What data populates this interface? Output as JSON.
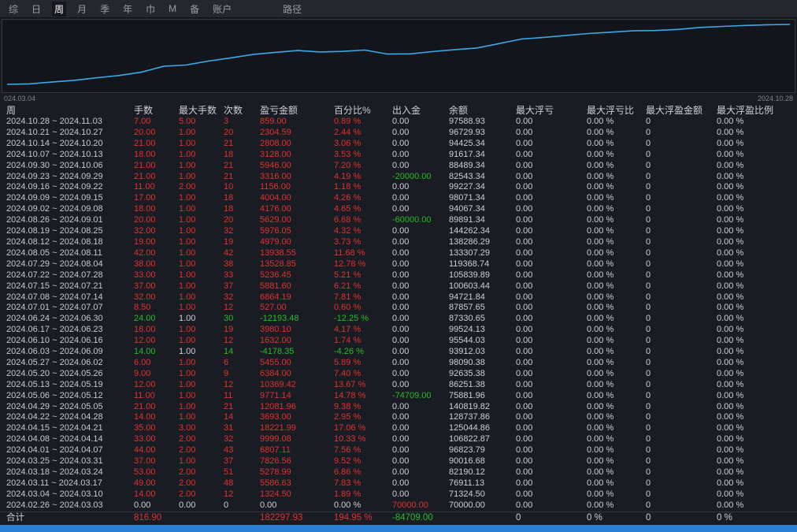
{
  "menu": {
    "items": [
      {
        "label": "综",
        "selected": false
      },
      {
        "label": "日",
        "selected": false
      },
      {
        "label": "周",
        "selected": true
      },
      {
        "label": "月",
        "selected": false
      },
      {
        "label": "季",
        "selected": false
      },
      {
        "label": "年",
        "selected": false
      },
      {
        "label": "巾",
        "selected": false
      },
      {
        "label": "M",
        "selected": false
      },
      {
        "label": "备",
        "selected": false
      },
      {
        "label": "账户",
        "selected": false
      },
      {
        "label": "路径",
        "selected": false,
        "far": true
      }
    ]
  },
  "chart": {
    "start_label": "024.03.04",
    "end_label": "2024.10.28",
    "line_color": "#3da8e8"
  },
  "chart_data": {
    "type": "line",
    "title": "",
    "x_axis": {
      "start": "024.03.04",
      "end": "2024.10.28"
    },
    "ylim": [
      0,
      182297.93
    ],
    "grid": false,
    "legend": "none",
    "series": [
      {
        "name": "cumulative-pnl",
        "values": [
          0,
          1324.5,
          6911.13,
          12190.12,
          20016.68,
          26823.79,
          36822.87,
          55044.86,
          58737.86,
          70819.82,
          80590.96,
          90960.38,
          97344.38,
          102799.38,
          98621.03,
          100253.03,
          104233.13,
          92039.65,
          92566.65,
          99430.84,
          105312.44,
          110548.89,
          124077.74,
          138016.29,
          142995.29,
          148971.34,
          154600.34,
          158776.34,
          162780.34,
          163936.34,
          167252.34,
          173198.34,
          176326.34,
          179134.34,
          181438.93,
          182297.93
        ]
      }
    ]
  },
  "colors": {
    "gain_red": "#e03232",
    "loss_green": "#28bc28",
    "text": "#ccd0d6",
    "chart_line": "#3da8e8",
    "bottom_bar": "#2b7fd4"
  },
  "table": {
    "headers": [
      "周",
      "手数",
      "最大手数",
      "次数",
      "盈亏金额",
      "百分比%",
      "出入金",
      "余额",
      "最大浮亏",
      "最大浮亏比",
      "最大浮盈金额",
      "最大浮盈比例"
    ],
    "float_cols": {
      "max_float_loss": "0.00",
      "max_float_loss_pct": "0.00 %",
      "max_float_profit": "0",
      "max_float_profit_pct": "0.00 %"
    },
    "rows": [
      {
        "p": "2024.10.28 ~ 2024.11.03",
        "l": "7.00",
        "ml": "5.00",
        "n": "3",
        "pnl": "859.00",
        "pct": "0.89 %",
        "cash": "0.00",
        "bal": "97588.93",
        "tone": "pos",
        "ct": "neutral"
      },
      {
        "p": "2024.10.21 ~ 2024.10.27",
        "l": "20.00",
        "ml": "1.00",
        "n": "20",
        "pnl": "2304.59",
        "pct": "2.44 %",
        "cash": "0.00",
        "bal": "96729.93",
        "tone": "pos",
        "ct": "neutral"
      },
      {
        "p": "2024.10.14 ~ 2024.10.20",
        "l": "21.00",
        "ml": "1.00",
        "n": "21",
        "pnl": "2808.00",
        "pct": "3.06 %",
        "cash": "0.00",
        "bal": "94425.34",
        "tone": "pos",
        "ct": "neutral"
      },
      {
        "p": "2024.10.07 ~ 2024.10.13",
        "l": "18.00",
        "ml": "1.00",
        "n": "18",
        "pnl": "3128.00",
        "pct": "3.53 %",
        "cash": "0.00",
        "bal": "91617.34",
        "tone": "pos",
        "ct": "neutral"
      },
      {
        "p": "2024.09.30 ~ 2024.10.06",
        "l": "21.00",
        "ml": "1.00",
        "n": "21",
        "pnl": "5946.00",
        "pct": "7.20 %",
        "cash": "0.00",
        "bal": "88489.34",
        "tone": "pos",
        "ct": "neutral"
      },
      {
        "p": "2024.09.23 ~ 2024.09.29",
        "l": "21.00",
        "ml": "1.00",
        "n": "21",
        "pnl": "3316.00",
        "pct": "4.19 %",
        "cash": "-20000.00",
        "bal": "82543.34",
        "tone": "pos",
        "ct": "neg"
      },
      {
        "p": "2024.09.16 ~ 2024.09.22",
        "l": "11.00",
        "ml": "2.00",
        "n": "10",
        "pnl": "1156.00",
        "pct": "1.18 %",
        "cash": "0.00",
        "bal": "99227.34",
        "tone": "pos",
        "ct": "neutral"
      },
      {
        "p": "2024.09.09 ~ 2024.09.15",
        "l": "17.00",
        "ml": "1.00",
        "n": "18",
        "pnl": "4004.00",
        "pct": "4.26 %",
        "cash": "0.00",
        "bal": "98071.34",
        "tone": "pos",
        "ct": "neutral"
      },
      {
        "p": "2024.09.02 ~ 2024.09.08",
        "l": "18.00",
        "ml": "1.00",
        "n": "18",
        "pnl": "4176.00",
        "pct": "4.65 %",
        "cash": "0.00",
        "bal": "94067.34",
        "tone": "pos",
        "ct": "neutral"
      },
      {
        "p": "2024.08.26 ~ 2024.09.01",
        "l": "20.00",
        "ml": "1.00",
        "n": "20",
        "pnl": "5629.00",
        "pct": "6.68 %",
        "cash": "-60000.00",
        "bal": "89891.34",
        "tone": "pos",
        "ct": "neg"
      },
      {
        "p": "2024.08.19 ~ 2024.08.25",
        "l": "32.00",
        "ml": "1.00",
        "n": "32",
        "pnl": "5976.05",
        "pct": "4.32 %",
        "cash": "0.00",
        "bal": "144262.34",
        "tone": "pos",
        "ct": "neutral"
      },
      {
        "p": "2024.08.12 ~ 2024.08.18",
        "l": "19.00",
        "ml": "1.00",
        "n": "19",
        "pnl": "4979.00",
        "pct": "3.73 %",
        "cash": "0.00",
        "bal": "138286.29",
        "tone": "pos",
        "ct": "neutral"
      },
      {
        "p": "2024.08.05 ~ 2024.08.11",
        "l": "42.00",
        "ml": "1.00",
        "n": "42",
        "pnl": "13938.55",
        "pct": "11.68 %",
        "cash": "0.00",
        "bal": "133307.29",
        "tone": "pos",
        "ct": "neutral"
      },
      {
        "p": "2024.07.29 ~ 2024.08.04",
        "l": "38.00",
        "ml": "1.00",
        "n": "38",
        "pnl": "13528.85",
        "pct": "12.78 %",
        "cash": "0.00",
        "bal": "119368.74",
        "tone": "pos",
        "ct": "neutral"
      },
      {
        "p": "2024.07.22 ~ 2024.07.28",
        "l": "33.00",
        "ml": "1.00",
        "n": "33",
        "pnl": "5236.45",
        "pct": "5.21 %",
        "cash": "0.00",
        "bal": "105839.89",
        "tone": "pos",
        "ct": "neutral"
      },
      {
        "p": "2024.07.15 ~ 2024.07.21",
        "l": "37.00",
        "ml": "1.00",
        "n": "37",
        "pnl": "5881.60",
        "pct": "6.21 %",
        "cash": "0.00",
        "bal": "100603.44",
        "tone": "pos",
        "ct": "neutral"
      },
      {
        "p": "2024.07.08 ~ 2024.07.14",
        "l": "32.00",
        "ml": "1.00",
        "n": "32",
        "pnl": "6864.19",
        "pct": "7.81 %",
        "cash": "0.00",
        "bal": "94721.84",
        "tone": "pos",
        "ct": "neutral"
      },
      {
        "p": "2024.07.01 ~ 2024.07.07",
        "l": "8.50",
        "ml": "1.00",
        "n": "12",
        "pnl": "527.00",
        "pct": "0.60 %",
        "cash": "0.00",
        "bal": "87857.65",
        "tone": "pos",
        "ct": "neutral"
      },
      {
        "p": "2024.06.24 ~ 2024.06.30",
        "l": "24.00",
        "ml": "1.00",
        "n": "30",
        "pnl": "-12193.48",
        "pct": "-12.25 %",
        "cash": "0.00",
        "bal": "87330.65",
        "tone": "neg",
        "ct": "neutral"
      },
      {
        "p": "2024.06.17 ~ 2024.06.23",
        "l": "18.00",
        "ml": "1.00",
        "n": "19",
        "pnl": "3980.10",
        "pct": "4.17 %",
        "cash": "0.00",
        "bal": "99524.13",
        "tone": "pos",
        "ct": "neutral"
      },
      {
        "p": "2024.06.10 ~ 2024.06.16",
        "l": "12.00",
        "ml": "1.00",
        "n": "12",
        "pnl": "1632.00",
        "pct": "1.74 %",
        "cash": "0.00",
        "bal": "95544.03",
        "tone": "pos",
        "ct": "neutral"
      },
      {
        "p": "2024.06.03 ~ 2024.06.09",
        "l": "14.00",
        "ml": "1.00",
        "n": "14",
        "pnl": "-4178.35",
        "pct": "-4.26 %",
        "cash": "0.00",
        "bal": "93912.03",
        "tone": "neg",
        "ct": "neutral"
      },
      {
        "p": "2024.05.27 ~ 2024.06.02",
        "l": "6.00",
        "ml": "1.00",
        "n": "6",
        "pnl": "5455.00",
        "pct": "5.89 %",
        "cash": "0.00",
        "bal": "98090.38",
        "tone": "pos",
        "ct": "neutral"
      },
      {
        "p": "2024.05.20 ~ 2024.05.26",
        "l": "9.00",
        "ml": "1.00",
        "n": "9",
        "pnl": "6384.00",
        "pct": "7.40 %",
        "cash": "0.00",
        "bal": "92635.38",
        "tone": "pos",
        "ct": "neutral"
      },
      {
        "p": "2024.05.13 ~ 2024.05.19",
        "l": "12.00",
        "ml": "1.00",
        "n": "12",
        "pnl": "10369.42",
        "pct": "13.67 %",
        "cash": "0.00",
        "bal": "86251.38",
        "tone": "pos",
        "ct": "neutral"
      },
      {
        "p": "2024.05.06 ~ 2024.05.12",
        "l": "11.00",
        "ml": "1.00",
        "n": "11",
        "pnl": "9771.14",
        "pct": "14.78 %",
        "cash": "-74709.00",
        "bal": "75881.96",
        "tone": "pos",
        "ct": "neg"
      },
      {
        "p": "2024.04.29 ~ 2024.05.05",
        "l": "21.00",
        "ml": "1.00",
        "n": "21",
        "pnl": "12081.96",
        "pct": "9.38 %",
        "cash": "0.00",
        "bal": "140819.82",
        "tone": "pos",
        "ct": "neutral"
      },
      {
        "p": "2024.04.22 ~ 2024.04.28",
        "l": "14.00",
        "ml": "1.00",
        "n": "14",
        "pnl": "3693.00",
        "pct": "2.95 %",
        "cash": "0.00",
        "bal": "128737.86",
        "tone": "pos",
        "ct": "neutral"
      },
      {
        "p": "2024.04.15 ~ 2024.04.21",
        "l": "35.00",
        "ml": "3.00",
        "n": "31",
        "pnl": "18221.99",
        "pct": "17.06 %",
        "cash": "0.00",
        "bal": "125044.86",
        "tone": "pos",
        "ct": "neutral"
      },
      {
        "p": "2024.04.08 ~ 2024.04.14",
        "l": "33.00",
        "ml": "2.00",
        "n": "32",
        "pnl": "9999.08",
        "pct": "10.33 %",
        "cash": "0.00",
        "bal": "106822.87",
        "tone": "pos",
        "ct": "neutral"
      },
      {
        "p": "2024.04.01 ~ 2024.04.07",
        "l": "44.00",
        "ml": "2.00",
        "n": "43",
        "pnl": "6807.11",
        "pct": "7.56 %",
        "cash": "0.00",
        "bal": "96823.79",
        "tone": "pos",
        "ct": "neutral"
      },
      {
        "p": "2024.03.25 ~ 2024.03.31",
        "l": "37.00",
        "ml": "1.00",
        "n": "37",
        "pnl": "7826.56",
        "pct": "9.52 %",
        "cash": "0.00",
        "bal": "90016.68",
        "tone": "pos",
        "ct": "neutral"
      },
      {
        "p": "2024.03.18 ~ 2024.03.24",
        "l": "53.00",
        "ml": "2.00",
        "n": "51",
        "pnl": "5278.99",
        "pct": "6.86 %",
        "cash": "0.00",
        "bal": "82190.12",
        "tone": "pos",
        "ct": "neutral"
      },
      {
        "p": "2024.03.11 ~ 2024.03.17",
        "l": "49.00",
        "ml": "2.00",
        "n": "48",
        "pnl": "5586.63",
        "pct": "7.83 %",
        "cash": "0.00",
        "bal": "76911.13",
        "tone": "pos",
        "ct": "neutral"
      },
      {
        "p": "2024.03.04 ~ 2024.03.10",
        "l": "14.00",
        "ml": "2.00",
        "n": "12",
        "pnl": "1324.50",
        "pct": "1.89 %",
        "cash": "0.00",
        "bal": "71324.50",
        "tone": "pos",
        "ct": "neutral"
      },
      {
        "p": "2024.02.26 ~ 2024.03.03",
        "l": "0.00",
        "ml": "0.00",
        "n": "0",
        "pnl": "0.00",
        "pct": "0.00 %",
        "cash": "70000.00",
        "bal": "70000.00",
        "tone": "zero",
        "ct": "pos"
      }
    ],
    "totals": {
      "label": "合计",
      "l": "816.90",
      "ml": "",
      "n": "",
      "pnl": "182297.93",
      "pct": "194.95 %",
      "cash": "-84709.00",
      "bal": "",
      "mfl": "0",
      "mflp": "0 %",
      "mfp": "0",
      "mfpp": "0 %"
    }
  }
}
